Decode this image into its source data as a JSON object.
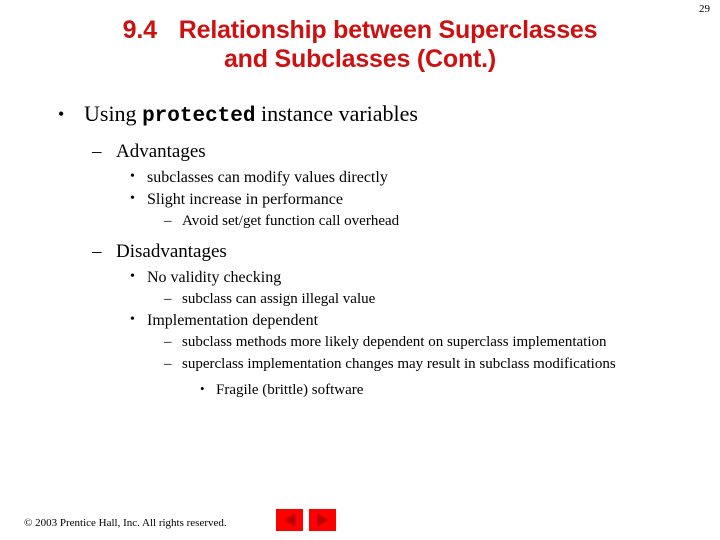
{
  "slide": {
    "page_number": "29",
    "background_color": "#ffffff",
    "title": {
      "number": "9.4",
      "line1": "Relationship between Superclasses",
      "line2": "and Subclasses (Cont.)",
      "color": "#cc1111"
    },
    "content": {
      "level1": {
        "marker": "•",
        "text_before": "Using",
        "code": "protected",
        "text_after": "instance variables"
      },
      "advantages": {
        "marker": "–",
        "label": "Advantages",
        "items": [
          {
            "marker": "•",
            "text": "subclasses can modify values directly"
          },
          {
            "marker": "•",
            "text": "Slight increase in performance"
          },
          {
            "marker": "–",
            "text": "Avoid set/get function call overhead"
          }
        ]
      },
      "disadvantages": {
        "marker": "–",
        "label": "Disadvantages",
        "items": [
          {
            "marker": "•",
            "text": "No validity checking"
          },
          {
            "marker": "–",
            "text": "subclass can assign illegal value"
          },
          {
            "marker": "•",
            "text": "Implementation dependent"
          },
          {
            "marker": "–",
            "text": "subclass methods more likely dependent on superclass implementation"
          },
          {
            "marker": "–",
            "text": "superclass implementation changes may result in subclass modifications"
          },
          {
            "marker": "•",
            "text": "Fragile (brittle) software"
          }
        ]
      }
    },
    "footer": {
      "copyright": "© 2003 Prentice Hall, Inc.  All rights reserved.",
      "nav": {
        "previous_label": "Previous slide",
        "next_label": "Next slide",
        "button_color": "#ff0000",
        "arrow_color": "#c00000"
      }
    }
  }
}
